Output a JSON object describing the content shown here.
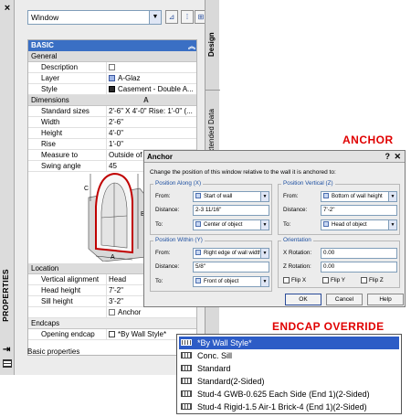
{
  "palette": {
    "title": "PROPERTIES",
    "style_selector": "Window",
    "side_tabs": [
      "Design",
      "Extended Data"
    ],
    "sections": {
      "basic": "BASIC",
      "general": "General",
      "dimensions": "Dimensions",
      "location": "Location",
      "endcaps": "Endcaps"
    },
    "general": [
      {
        "key": "Description",
        "value": ""
      },
      {
        "key": "Layer",
        "value": "A-Glaz"
      },
      {
        "key": "Style",
        "value": "Casement - Double A..."
      }
    ],
    "dimensions": [
      {
        "letter": "",
        "key": "Standard sizes",
        "value": "2'-6\" X 4'-0\" Rise: 1'-0\" (..."
      },
      {
        "letter": "A",
        "key": "Width",
        "value": "2'-6\""
      },
      {
        "letter": "B",
        "key": "Height",
        "value": "4'-0\""
      },
      {
        "letter": "C",
        "key": "Rise",
        "value": "1'-0\""
      },
      {
        "letter": "",
        "key": "Measure to",
        "value": "Outside of F..."
      },
      {
        "letter": "",
        "key": "Swing angle",
        "value": "45"
      }
    ],
    "diagram_letters": [
      "A",
      "B",
      "C"
    ],
    "location": [
      {
        "key": "Vertical alignment",
        "value": "Head"
      },
      {
        "key": "Head height",
        "value": "7'-2\""
      },
      {
        "key": "Sill height",
        "value": "3'-2\""
      },
      {
        "key": "",
        "value": "Anchor"
      }
    ],
    "endcaps": [
      {
        "key": "Opening endcap",
        "value": "*By Wall Style*"
      }
    ],
    "footer": "Basic properties"
  },
  "anchor_dialog": {
    "callout": "ANCHOR",
    "title": "Anchor",
    "help": "?",
    "close": "✕",
    "description": "Change the position of this window relative to the wall it is anchored to:",
    "position_along": {
      "title": "Position Along (X)",
      "from_label": "From:",
      "from_value": "Start of wall",
      "distance_label": "Distance:",
      "distance_value": "2-3 11/16\"",
      "to_label": "To:",
      "to_value": "Center of object"
    },
    "position_vertical": {
      "title": "Position Vertical (Z)",
      "from_label": "From:",
      "from_value": "Bottom of wall height",
      "distance_label": "Distance:",
      "distance_value": "7'-2\"",
      "to_label": "To:",
      "to_value": "Head of object"
    },
    "position_within": {
      "title": "Position Within (Y)",
      "from_label": "From:",
      "from_value": "Right edge of wall width",
      "distance_label": "Distance:",
      "distance_value": "5/8\"",
      "to_label": "To:",
      "to_value": "Front of object"
    },
    "orientation": {
      "title": "Orientation",
      "x_label": "X Rotation:",
      "x_value": "0.00",
      "z_label": "Z Rotation:",
      "z_value": "0.00",
      "flip_x": "Flip X",
      "flip_y": "Flip Y",
      "flip_z": "Flip Z"
    },
    "buttons": {
      "ok": "OK",
      "cancel": "Cancel",
      "help": "Help"
    }
  },
  "endcap_override": {
    "callout": "ENDCAP OVERRIDE",
    "items": [
      "*By Wall Style*",
      "Conc. Sill",
      "Standard",
      "Standard(2-Sided)",
      "Stud-4 GWB-0.625 Each Side (End 1)(2-Sided)",
      "Stud-4 Rigid-1.5 Air-1 Brick-4 (End 1)(2-Sided)"
    ],
    "selected_index": 0
  },
  "colors": {
    "section_header": "#3a6fc4",
    "selection": "#2d5cc6",
    "callout": "#e00000"
  }
}
